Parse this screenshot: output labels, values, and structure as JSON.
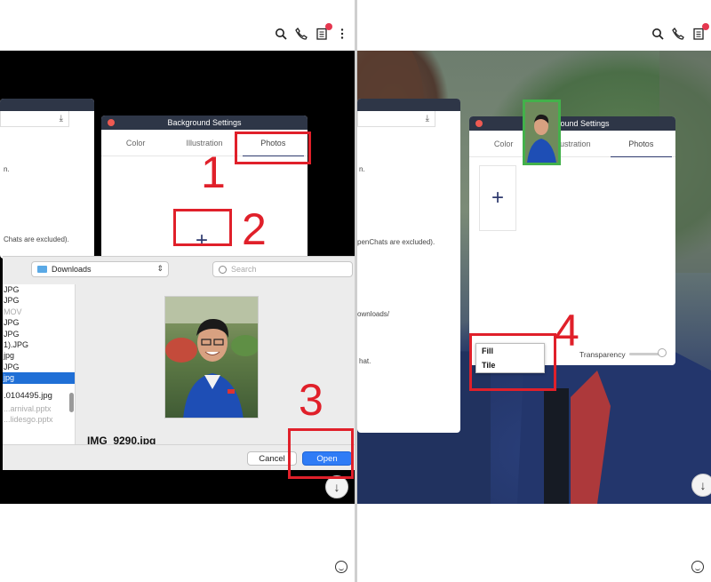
{
  "colors": {
    "accent": "#2f7cf6",
    "annotation": "#e0202a",
    "titlebar": "#2e3647",
    "thumb_border": "#43b14b"
  },
  "topbar_icons": [
    "search-icon",
    "phone-icon",
    "notes-icon",
    "more-icon"
  ],
  "left": {
    "background_settings": {
      "title": "Background Settings",
      "tabs": [
        "Color",
        "Illustration",
        "Photos"
      ],
      "add_glyph": "+"
    },
    "chat_snippets": [
      "n.",
      "Chats are excluded)."
    ],
    "file_dialog": {
      "location": "Downloads",
      "search_placeholder": "Search",
      "files": [
        "JPG",
        "JPG",
        "MOV",
        "JPG",
        "JPG",
        "1).JPG",
        "jpg",
        "JPG",
        "jpg",
        ".0104495.jpg",
        "...arnival.pptx",
        "...lidesgo.pptx"
      ],
      "selected_index": 8,
      "preview_name": "IMG_9290.jpg",
      "cancel_label": "Cancel",
      "open_label": "Open"
    },
    "steps": [
      "1",
      "2",
      "3"
    ]
  },
  "right": {
    "background_settings": {
      "title": "Background Settings",
      "tabs": [
        "Color",
        "Illustration",
        "Photos"
      ],
      "add_glyph": "+",
      "fill_options": [
        "Fill",
        "Tile"
      ],
      "transparency_label": "Transparency"
    },
    "chat_snippets": [
      "n.",
      "penChats are excluded).",
      "ownloads/",
      "hat."
    ],
    "steps": [
      "4"
    ]
  },
  "scroll_glyph": "↓"
}
